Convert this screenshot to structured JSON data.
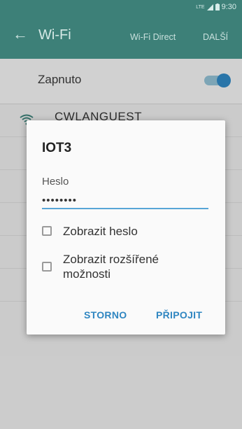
{
  "statusbar": {
    "network": "LTE",
    "time": "9:30"
  },
  "appbar": {
    "title": "Wi-Fi",
    "actions": [
      "Wi-Fi Direct",
      "DALŠÍ"
    ]
  },
  "toggle": {
    "label": "Zapnuto",
    "state": "on"
  },
  "networks": [
    {
      "name": "CWLANGUEST"
    }
  ],
  "dialog": {
    "title": "IOT3",
    "password_label": "Heslo",
    "password_value": "••••••••",
    "options": [
      "Zobrazit heslo",
      "Zobrazit rozšířené možnosti"
    ],
    "cancel_label": "STORNO",
    "connect_label": "PŘIPOJIT"
  },
  "colors": {
    "appbar": "#3d8078",
    "accent": "#2f86c1"
  }
}
